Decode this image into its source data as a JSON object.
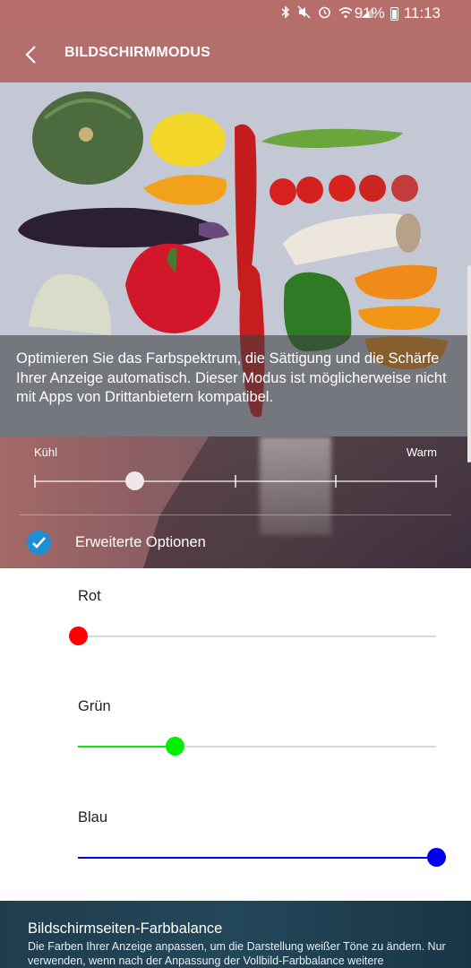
{
  "status_bar": {
    "battery": "91%",
    "time": "11:13",
    "icons": [
      "bluetooth-icon",
      "mute-icon",
      "alarm-icon",
      "wifi-icon",
      "signal-icon",
      "battery-icon"
    ]
  },
  "app_bar": {
    "title": "BILDSCHIRMMODUS",
    "back_icon": "back-arrow-icon"
  },
  "preview": {
    "description": "Optimieren Sie das Farbspektrum, die Sättigung und die Schärfe Ihrer Anzeige automatisch. Dieser Modus ist möglicherweise nicht mit Apps von Drittanbietern kompatibel."
  },
  "color_temperature": {
    "min_label": "Kühl",
    "max_label": "Warm",
    "value_fraction": 0.25,
    "steps": 4
  },
  "advanced_options": {
    "label": "Erweiterte Optionen",
    "checked": true,
    "accent": "#1e8fd5"
  },
  "rgb_sliders": [
    {
      "label": "Rot",
      "value_fraction": 0.0,
      "color": "#ff0000"
    },
    {
      "label": "Grün",
      "value_fraction": 0.27,
      "color": "#00ee00"
    },
    {
      "label": "Blau",
      "value_fraction": 1.0,
      "color": "#0000ee"
    }
  ],
  "edge_balance": {
    "title": "Bildschirmseiten-Farbbalance",
    "description": "Die Farben Ihrer Anzeige anpassen, um die Darstellung weißer Töne zu ändern. Nur verwenden, wenn nach der Anpassung der Vollbild-Farbbalance weitere"
  }
}
